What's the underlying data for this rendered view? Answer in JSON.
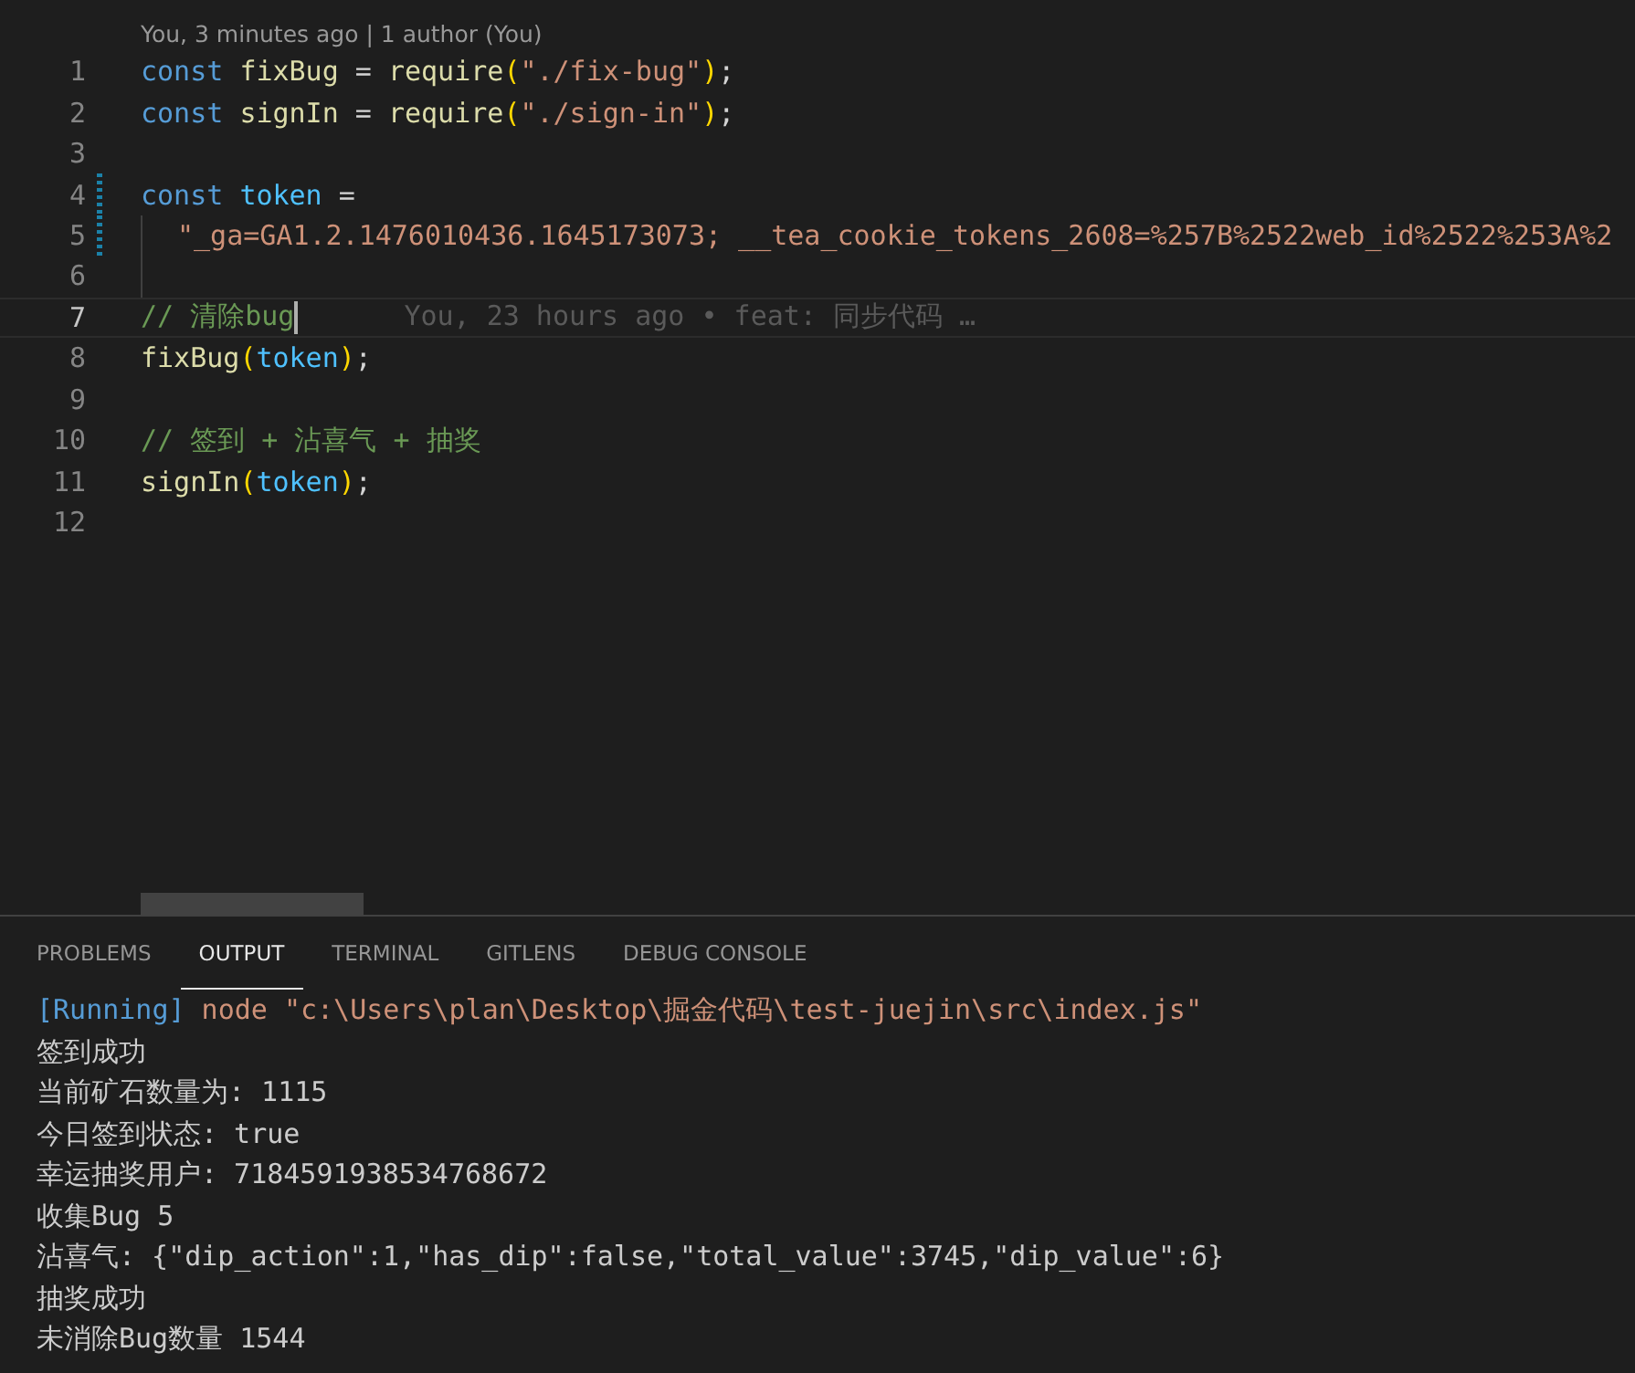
{
  "editor": {
    "codelens": "You, 3 minutes ago | 1 author (You)",
    "lines": [
      {
        "number": "1",
        "tokens": [
          {
            "kind": "keyword",
            "text": "const "
          },
          {
            "kind": "func",
            "text": "fixBug"
          },
          {
            "kind": "plain",
            "text": " = "
          },
          {
            "kind": "func",
            "text": "require"
          },
          {
            "kind": "bracket",
            "text": "("
          },
          {
            "kind": "string",
            "text": "\"./fix-bug\""
          },
          {
            "kind": "bracket",
            "text": ")"
          },
          {
            "kind": "plain",
            "text": ";"
          }
        ]
      },
      {
        "number": "2",
        "tokens": [
          {
            "kind": "keyword",
            "text": "const "
          },
          {
            "kind": "func",
            "text": "signIn"
          },
          {
            "kind": "plain",
            "text": " = "
          },
          {
            "kind": "func",
            "text": "require"
          },
          {
            "kind": "bracket",
            "text": "("
          },
          {
            "kind": "string",
            "text": "\"./sign-in\""
          },
          {
            "kind": "bracket",
            "text": ")"
          },
          {
            "kind": "plain",
            "text": ";"
          }
        ]
      },
      {
        "number": "3"
      },
      {
        "number": "4",
        "modified": true,
        "tokens": [
          {
            "kind": "keyword",
            "text": "const "
          },
          {
            "kind": "variable",
            "text": "token"
          },
          {
            "kind": "plain",
            "text": " ="
          }
        ]
      },
      {
        "number": "5",
        "modified": true,
        "indent": true,
        "tokens": [
          {
            "kind": "string",
            "text": "\"_ga=GA1.2.1476010436.1645173073; __tea_cookie_tokens_2608=%257B%2522web_id%2522%253A%2"
          }
        ]
      },
      {
        "number": "6",
        "indent": true
      },
      {
        "number": "7",
        "current": true,
        "blame": "You, 23 hours ago • feat: 同步代码 …",
        "tokens": [
          {
            "kind": "comment",
            "text": "// 清除bug"
          }
        ]
      },
      {
        "number": "8",
        "tokens": [
          {
            "kind": "func",
            "text": "fixBug"
          },
          {
            "kind": "bracket",
            "text": "("
          },
          {
            "kind": "variable",
            "text": "token"
          },
          {
            "kind": "bracket",
            "text": ")"
          },
          {
            "kind": "plain",
            "text": ";"
          }
        ]
      },
      {
        "number": "9"
      },
      {
        "number": "10",
        "tokens": [
          {
            "kind": "comment",
            "text": "// 签到 + 沾喜气 + 抽奖"
          }
        ]
      },
      {
        "number": "11",
        "tokens": [
          {
            "kind": "func",
            "text": "signIn"
          },
          {
            "kind": "bracket",
            "text": "("
          },
          {
            "kind": "variable",
            "text": "token"
          },
          {
            "kind": "bracket",
            "text": ")"
          },
          {
            "kind": "plain",
            "text": ";"
          }
        ]
      },
      {
        "number": "12"
      }
    ]
  },
  "panel": {
    "tabs": [
      {
        "label": "PROBLEMS",
        "selected": false
      },
      {
        "label": "OUTPUT",
        "selected": true
      },
      {
        "label": "TERMINAL",
        "selected": false
      },
      {
        "label": "GITLENS",
        "selected": false
      },
      {
        "label": "DEBUG CONSOLE",
        "selected": false
      }
    ],
    "output": [
      {
        "kind": "run",
        "tag": "[Running]",
        "text": " node \"c:\\Users\\plan\\Desktop\\掘金代码\\test-juejin\\src\\index.js\""
      },
      {
        "kind": "plain",
        "text": "签到成功"
      },
      {
        "kind": "plain",
        "text": "当前矿石数量为: 1115"
      },
      {
        "kind": "plain",
        "text": "今日签到状态: true"
      },
      {
        "kind": "plain",
        "text": "幸运抽奖用户: 7184591938534768672"
      },
      {
        "kind": "plain",
        "text": "收集Bug 5"
      },
      {
        "kind": "plain",
        "text": "沾喜气: {\"dip_action\":1,\"has_dip\":false,\"total_value\":3745,\"dip_value\":6}"
      },
      {
        "kind": "plain",
        "text": "抽奖成功"
      },
      {
        "kind": "plain",
        "text": "未消除Bug数量 1544"
      }
    ]
  }
}
